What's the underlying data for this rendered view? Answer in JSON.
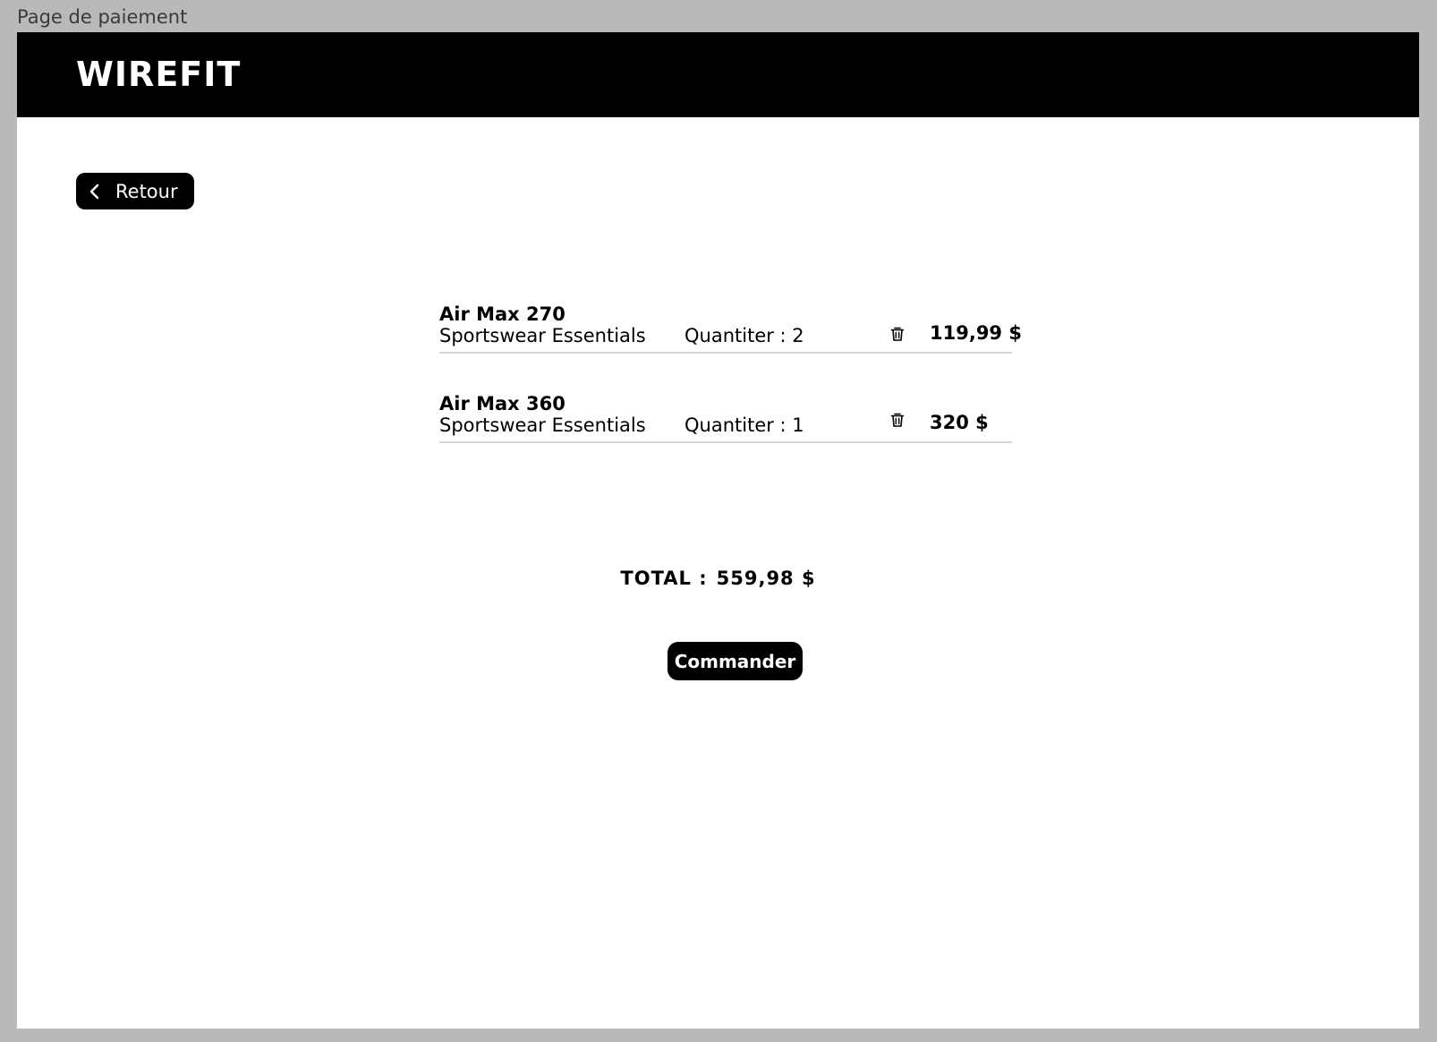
{
  "frame": {
    "label": "Page de paiement"
  },
  "header": {
    "logo": "WIREFIT"
  },
  "nav": {
    "back_label": "Retour"
  },
  "cart": {
    "items": [
      {
        "name": "Air Max 270",
        "subtitle": "Sportswear Essentials",
        "quantity": "Quantiter : 2",
        "price": "119,99 $"
      },
      {
        "name": "Air Max 360",
        "subtitle": "Sportswear Essentials",
        "quantity": "Quantiter : 1",
        "price": "320 $"
      }
    ],
    "total_label": "TOTAL :",
    "total_value": "559,98 $"
  },
  "actions": {
    "order_label": "Commander"
  },
  "colors": {
    "background": "#b9b9b9",
    "header": "#000000",
    "page": "#ffffff",
    "divider": "#d6d6d6"
  },
  "icons": {
    "back": "chevron-left-icon",
    "delete": "trash-icon"
  }
}
